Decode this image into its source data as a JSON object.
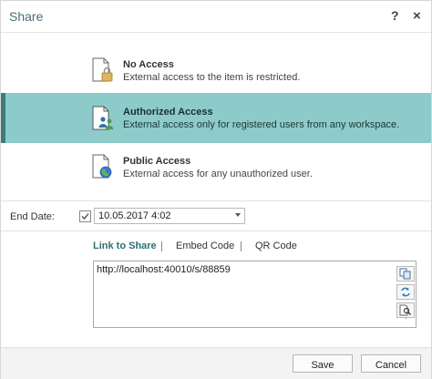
{
  "dialog": {
    "title": "Share",
    "help_label": "?",
    "close_label": "×"
  },
  "access_options": [
    {
      "title": "No Access",
      "description": "External access to the item is restricted.",
      "icon": "lock-document-icon",
      "selected": false
    },
    {
      "title": "Authorized Access",
      "description": "External access only for registered users from any workspace.",
      "icon": "users-document-icon",
      "selected": true
    },
    {
      "title": "Public Access",
      "description": "External access for any unauthorized user.",
      "icon": "globe-document-icon",
      "selected": false
    }
  ],
  "end_date": {
    "label": "End Date:",
    "checked": true,
    "value": "10.05.2017 4:02"
  },
  "tabs": [
    {
      "label": "Link to Share",
      "active": true
    },
    {
      "label": "Embed Code",
      "active": false
    },
    {
      "label": "QR Code",
      "active": false
    }
  ],
  "link": {
    "url": "http://localhost:40010/s/88859"
  },
  "side_buttons": [
    "copy-icon",
    "refresh-icon",
    "preview-icon"
  ],
  "footer": {
    "save_label": "Save",
    "cancel_label": "Cancel"
  },
  "colors": {
    "selected_bg": "#8ccbc9",
    "selected_border": "#3f7c7f",
    "accent_text": "#2f6f73",
    "title_text": "#4a6e78"
  }
}
